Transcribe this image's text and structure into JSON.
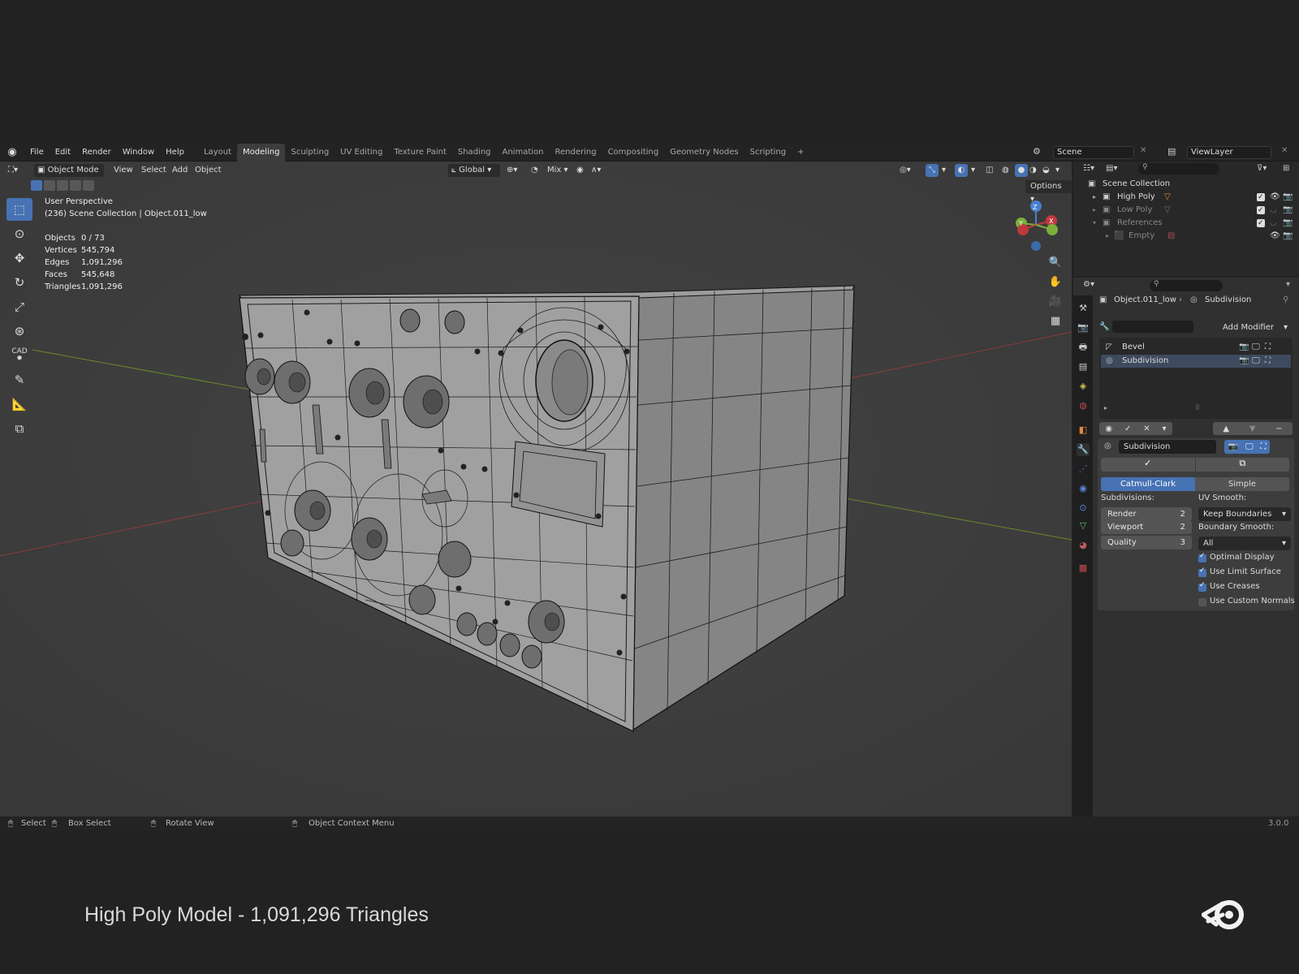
{
  "menubar": {
    "items": [
      "File",
      "Edit",
      "Render",
      "Window",
      "Help"
    ],
    "workspaces": [
      "Layout",
      "Modeling",
      "Sculpting",
      "UV Editing",
      "Texture Paint",
      "Shading",
      "Animation",
      "Rendering",
      "Compositing",
      "Geometry Nodes",
      "Scripting"
    ],
    "active_workspace": "Modeling",
    "add_tab": "+",
    "scene": "Scene",
    "view_layer": "ViewLayer"
  },
  "viewport_header": {
    "mode": "Object Mode",
    "menus": [
      "View",
      "Select",
      "Add",
      "Object"
    ],
    "orientation": "Global",
    "snap_mode": "Mix",
    "options": "Options"
  },
  "viewport": {
    "perspective": "User Perspective",
    "collection_path": "(236) Scene Collection | Object.011_low",
    "stats": [
      {
        "label": "Objects",
        "value": "0 / 73"
      },
      {
        "label": "Vertices",
        "value": "545,794"
      },
      {
        "label": "Edges",
        "value": "1,091,296"
      },
      {
        "label": "Faces",
        "value": "545,648"
      },
      {
        "label": "Triangles",
        "value": "1,091,296"
      }
    ],
    "gizmo_axes": {
      "x": "X",
      "y": "Y",
      "z": "Z"
    },
    "tool_icons": [
      "select-box-icon",
      "cursor-icon",
      "move-icon",
      "rotate-icon",
      "scale-icon",
      "transform-icon",
      "cad-icon",
      "annotate-icon",
      "measure-icon",
      "add-cube-icon"
    ],
    "cad_label": "CAD"
  },
  "outliner": {
    "root": "Scene Collection",
    "items": [
      {
        "label": "High Poly",
        "dim": false
      },
      {
        "label": "Low Poly",
        "dim": true
      },
      {
        "label": "References",
        "dim": true
      },
      {
        "label": "Empty",
        "dim": true
      }
    ]
  },
  "properties": {
    "breadcrumb_object": "Object.011_low",
    "breadcrumb_modifier": "Subdivision",
    "add_modifier": "Add Modifier",
    "modifiers": [
      {
        "label": "Bevel",
        "selected": false
      },
      {
        "label": "Subdivision",
        "selected": true
      }
    ],
    "panel_name": "Subdivision",
    "algo_tabs": [
      "Catmull-Clark",
      "Simple"
    ],
    "active_algo": "Catmull-Clark",
    "subdivisions_label": "Subdivisions:",
    "render_label": "Render",
    "render_value": "2",
    "viewport_label": "Viewport",
    "viewport_value": "2",
    "quality_label": "Quality",
    "quality_value": "3",
    "uv_smooth_label": "UV Smooth:",
    "uv_smooth_value": "Keep Boundaries",
    "boundary_smooth_label": "Boundary Smooth:",
    "boundary_smooth_value": "All",
    "checkboxes": [
      {
        "label": "Optimal Display",
        "checked": true
      },
      {
        "label": "Use Limit Surface",
        "checked": true
      },
      {
        "label": "Use Creases",
        "checked": true
      },
      {
        "label": "Use Custom Normals",
        "checked": false
      }
    ]
  },
  "statusbar": {
    "select": "Select",
    "box_select": "Box Select",
    "rotate_view": "Rotate View",
    "context_menu": "Object Context Menu",
    "version": "3.0.0"
  },
  "caption": "High Poly Model - 1,091,296 Triangles",
  "colors": {
    "accent": "#4772b3",
    "viewport_bg": "#3d3d3d",
    "mesh_face": "#9a9a9a",
    "wire": "#111111"
  }
}
